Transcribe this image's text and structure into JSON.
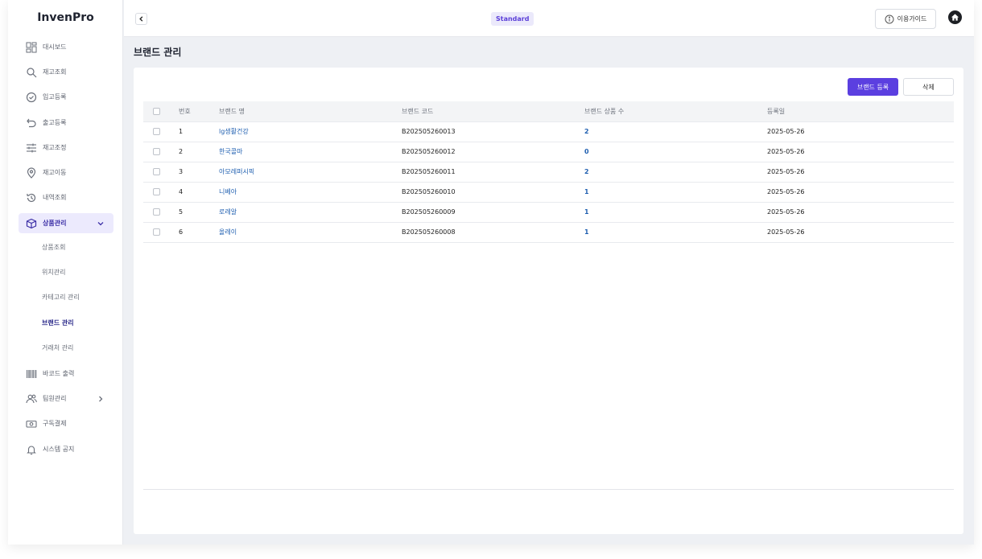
{
  "app": {
    "name": "InvenPro"
  },
  "sidebar": {
    "items": [
      {
        "label": "대시보드",
        "icon": "dashboard-icon"
      },
      {
        "label": "재고조회",
        "icon": "search-icon"
      },
      {
        "label": "입고등록",
        "icon": "check-circle-icon"
      },
      {
        "label": "출고등록",
        "icon": "undo-arrow-icon"
      },
      {
        "label": "재고조정",
        "icon": "sliders-icon"
      },
      {
        "label": "재고이동",
        "icon": "location-pin-icon"
      },
      {
        "label": "내역조회",
        "icon": "history-icon"
      },
      {
        "label": "상품관리",
        "icon": "box-icon"
      },
      {
        "label": "바코드 출력",
        "icon": "barcode-icon"
      },
      {
        "label": "팀원관리",
        "icon": "users-icon"
      },
      {
        "label": "구독결제",
        "icon": "cash-icon"
      },
      {
        "label": "시스템 공지",
        "icon": "bell-icon"
      }
    ],
    "product_submenu": [
      "상품조회",
      "위치관리",
      "카테고리 관리",
      "브랜드 관리",
      "거래처 관리"
    ]
  },
  "topbar": {
    "plan": "Standard",
    "guide_label": "이용가이드"
  },
  "page": {
    "title": "브랜드 관리"
  },
  "actions": {
    "register": "브랜드 등록",
    "delete": "삭제"
  },
  "table": {
    "headers": [
      "번호",
      "브랜드 명",
      "브랜드 코드",
      "브랜드 상품 수",
      "등록일"
    ],
    "rows": [
      {
        "no": "1",
        "name": "lg생활건강",
        "code": "B202505260013",
        "count": "2",
        "date": "2025-05-26"
      },
      {
        "no": "2",
        "name": "한국콜마",
        "code": "B202505260012",
        "count": "0",
        "date": "2025-05-26"
      },
      {
        "no": "3",
        "name": "아모레퍼시픽",
        "code": "B202505260011",
        "count": "2",
        "date": "2025-05-26"
      },
      {
        "no": "4",
        "name": "니베아",
        "code": "B202505260010",
        "count": "1",
        "date": "2025-05-26"
      },
      {
        "no": "5",
        "name": "로레알",
        "code": "B202505260009",
        "count": "1",
        "date": "2025-05-26"
      },
      {
        "no": "6",
        "name": "올레이",
        "code": "B202505260008",
        "count": "1",
        "date": "2025-05-26"
      }
    ]
  },
  "colors": {
    "accent": "#5b3fe0",
    "link": "#1f5fb0",
    "active_bg": "#eceafd"
  }
}
